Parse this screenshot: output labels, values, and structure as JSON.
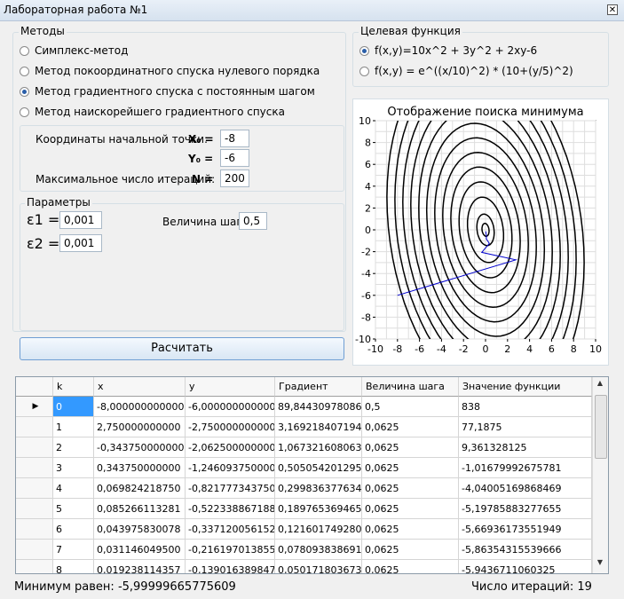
{
  "window": {
    "title": "Лабораторная работа №1",
    "close_glyph": "✕"
  },
  "methods": {
    "title": "Методы",
    "options": [
      {
        "label": "Симплекс-метод",
        "selected": false
      },
      {
        "label": "Метод покоординатного спуска нулевого порядка",
        "selected": false
      },
      {
        "label": "Метод градиентного спуска с постоянным шагом",
        "selected": true
      },
      {
        "label": "Метод наискорейшего градиентного спуска",
        "selected": false
      }
    ],
    "start_point": {
      "caption": "Координаты начальной точки:",
      "x0_label": "X₀ =",
      "x0_value": "-8",
      "y0_label": "Y₀ =",
      "y0_value": "-6",
      "iter_caption": "Максимальное число итераций:",
      "n_label": "N =",
      "n_value": "200"
    },
    "params": {
      "title": "Параметры",
      "eps1_label": "ε1 =",
      "eps1_value": "0,001",
      "eps2_label": "ε2 =",
      "eps2_value": "0,001",
      "step_label": "Величина шага",
      "step_value": "0,5"
    },
    "calculate_label": "Расчитать"
  },
  "target_function": {
    "title": "Целевая функция",
    "options": [
      {
        "label": "f(x,y)=10x^2 + 3y^2 + 2xy-6",
        "selected": true
      },
      {
        "label": "f(x,y) = e^((x/10)^2) * (10+(y/5)^2)",
        "selected": false
      }
    ]
  },
  "chart_data": {
    "type": "line",
    "title": "Отображение поиска минимума",
    "xlim": [
      -10,
      10
    ],
    "ylim": [
      -10,
      10
    ],
    "xticks": [
      "-10",
      "-8",
      "-6",
      "-4",
      "-2",
      "0",
      "2",
      "4",
      "6",
      "8",
      "10"
    ],
    "yticks": [
      "10",
      "8",
      "6",
      "4",
      "2",
      "0",
      "-2",
      "-4",
      "-6",
      "-8",
      "-10"
    ],
    "grid": true,
    "contour_levels": [
      -5,
      0,
      20,
      50,
      90,
      140,
      200,
      270,
      350,
      440,
      540,
      650,
      770
    ],
    "path": {
      "x": [
        -8,
        2.75,
        -0.34375,
        0.34375,
        0.06982421875,
        0.085266113281,
        0.043975830078,
        0.0311460495,
        0.019238114357
      ],
      "y": [
        -6,
        -2.75,
        -2.0625,
        -1.24609375,
        -0.82177734375,
        -0.522338867188,
        -0.337120056152,
        -0.216197013855,
        -0.139016389847
      ]
    }
  },
  "table": {
    "columns": [
      "k",
      "x",
      "y",
      "Градиент",
      "Величина шага",
      "Значение функции"
    ],
    "current_row_marker": "▶",
    "rows": [
      [
        "0",
        "-8,000000000000",
        "-6,000000000000",
        "89,84430978086...",
        "0,5",
        "838"
      ],
      [
        "1",
        "2,750000000000",
        "-2,750000000000",
        "3,169218407194...",
        "0,0625",
        "77,1875"
      ],
      [
        "2",
        "-0,343750000000",
        "-2,062500000000",
        "1,067321608063...",
        "0,0625",
        "9,361328125"
      ],
      [
        "3",
        "0,343750000000",
        "-1,246093750000",
        "0,505054201295...",
        "0,0625",
        "-1,01679992675781"
      ],
      [
        "4",
        "0,069824218750",
        "-0,821777343750",
        "0,299836377634...",
        "0,0625",
        "-4,04005169868469"
      ],
      [
        "5",
        "0,085266113281",
        "-0,522338867188",
        "0,189765369465...",
        "0,0625",
        "-5,19785883277655"
      ],
      [
        "6",
        "0,043975830078",
        "-0,337120056152",
        "0,121601749280...",
        "0,0625",
        "-5,66936173551949"
      ],
      [
        "7",
        "0,031146049500",
        "-0,216197013855",
        "0,078093838691...",
        "0,0625",
        "-5,86354315539666"
      ],
      [
        "8",
        "0,019238114357",
        "-0,139016389847",
        "0,050171803673...",
        "0,0625",
        "-5,9436711060325"
      ]
    ]
  },
  "status": {
    "minimum": "Минимум равен: -5,99999665775609",
    "iterations": "Число итераций: 19"
  }
}
